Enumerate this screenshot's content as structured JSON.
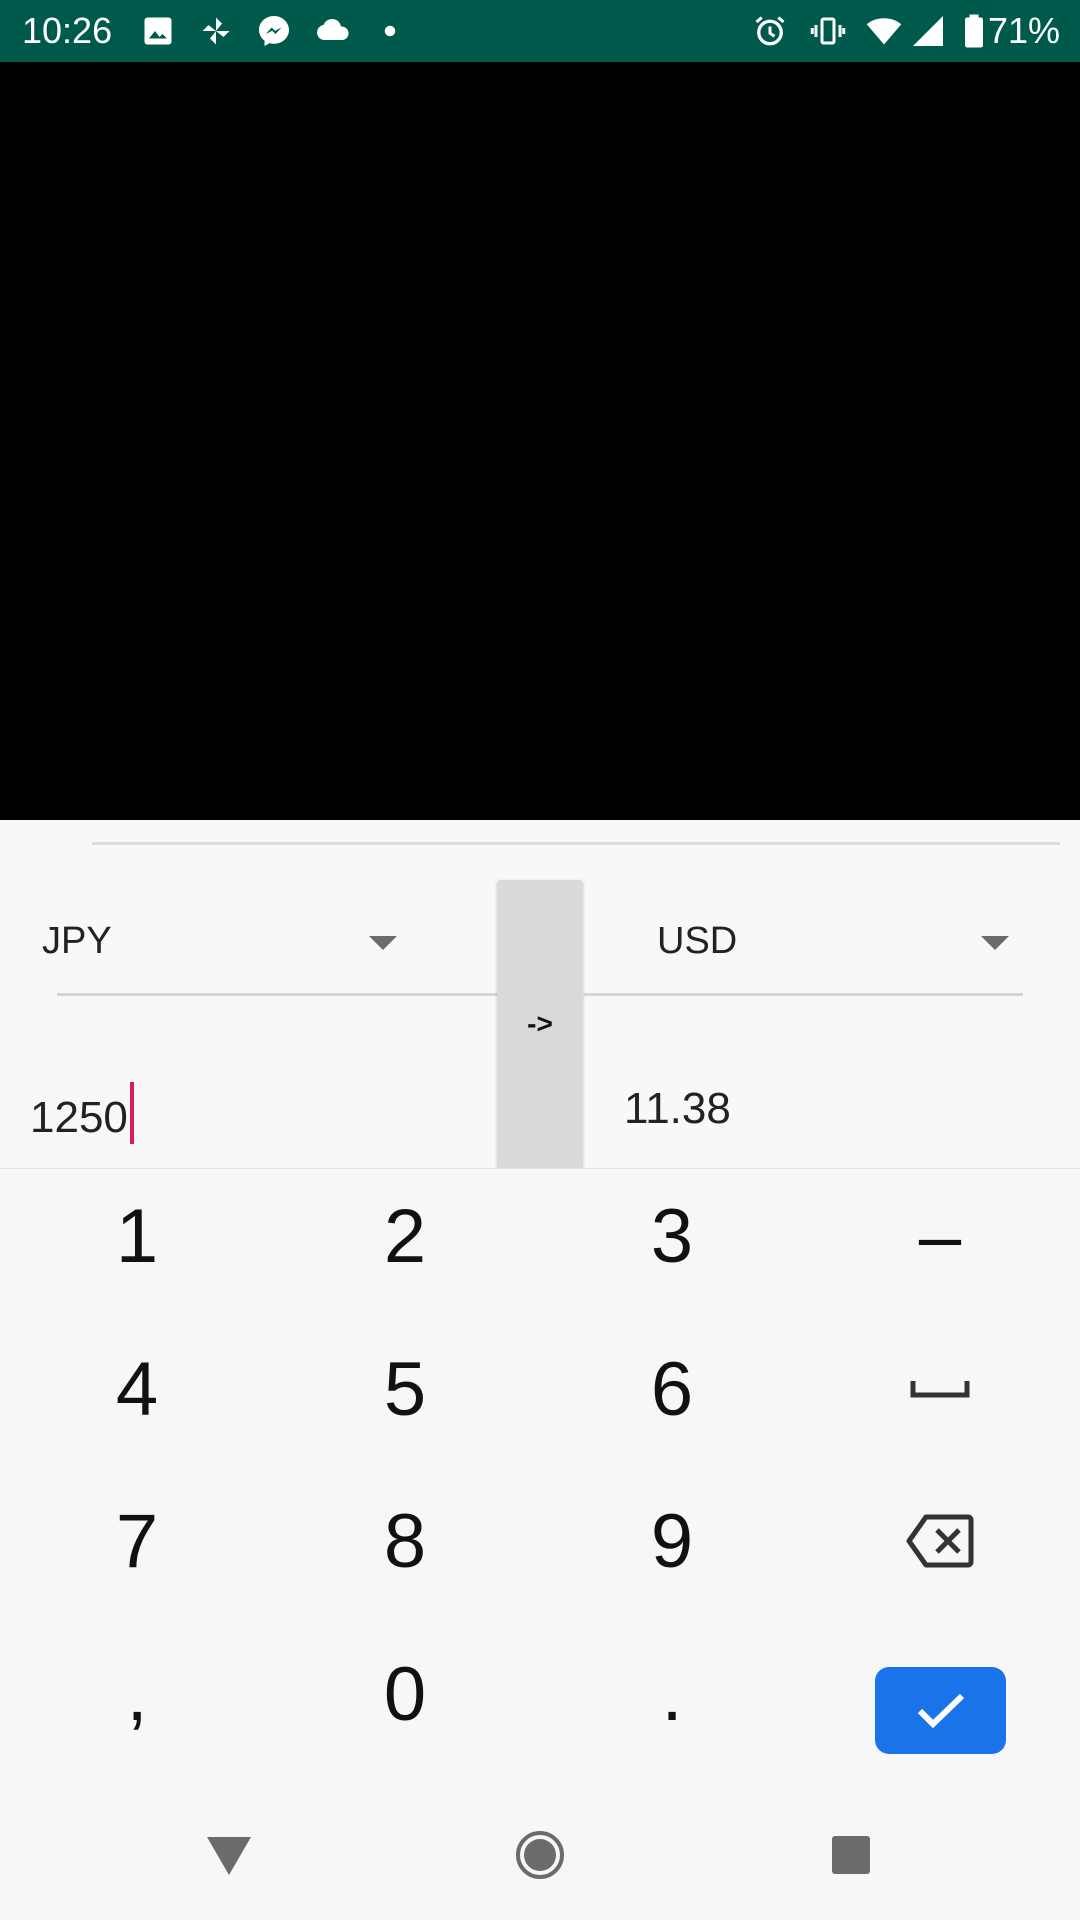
{
  "status_bar": {
    "time": "10:26",
    "battery": "71%",
    "left_icons": [
      "gallery-icon",
      "pinwheel-icon",
      "messenger-icon",
      "cloud-icon",
      "dot-icon"
    ],
    "right_icons": [
      "alarm-icon",
      "vibrate-icon",
      "wifi-icon",
      "signal-icon",
      "battery-icon"
    ],
    "background": "#005a4b"
  },
  "converter": {
    "from_currency": "JPY",
    "to_currency": "USD",
    "swap_label": "->",
    "from_amount": "1250",
    "to_amount": "11.38"
  },
  "keypad": {
    "keys": [
      "1",
      "2",
      "3",
      "–",
      "4",
      "5",
      "6",
      "space",
      "7",
      "8",
      "9",
      "backspace",
      ",",
      "0",
      ".",
      "done"
    ],
    "done_color": "#1a73e8"
  },
  "nav_bar": {
    "buttons": [
      "back-icon",
      "home-icon",
      "recents-icon"
    ]
  }
}
